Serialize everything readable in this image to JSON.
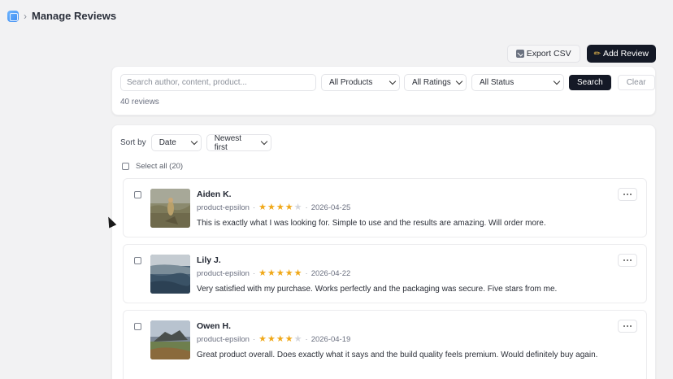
{
  "header": {
    "title": "Manage Reviews",
    "separator": "›"
  },
  "toolbar": {
    "export_label": "Export CSV",
    "add_label": "Add Review"
  },
  "filters": {
    "search_placeholder": "Search author, content, product...",
    "products": "All Products",
    "ratings": "All Ratings",
    "status": "All Status",
    "search_label": "Search",
    "clear_label": "Clear",
    "count": "40 reviews"
  },
  "sort": {
    "label": "Sort by",
    "field": "Date",
    "order": "Newest first"
  },
  "select_all": "Select all (20)",
  "reviews": [
    {
      "author": "Aiden K.",
      "product": "product-epsilon",
      "rating": 4,
      "date": "2026-04-25",
      "content": "This is exactly what I was looking for. Simple to use and the results are amazing. Will order more."
    },
    {
      "author": "Lily J.",
      "product": "product-epsilon",
      "rating": 5,
      "date": "2026-04-22",
      "content": "Very satisfied with my purchase. Works perfectly and the packaging was secure. Five stars from me."
    },
    {
      "author": "Owen H.",
      "product": "product-epsilon",
      "rating": 4,
      "date": "2026-04-19",
      "content": "Great product overall. Does exactly what it says and the build quality feels premium. Would definitely buy again."
    }
  ],
  "colors": {
    "accent": "#141926",
    "star": "#f0a818",
    "background": "#f2f2f3"
  }
}
